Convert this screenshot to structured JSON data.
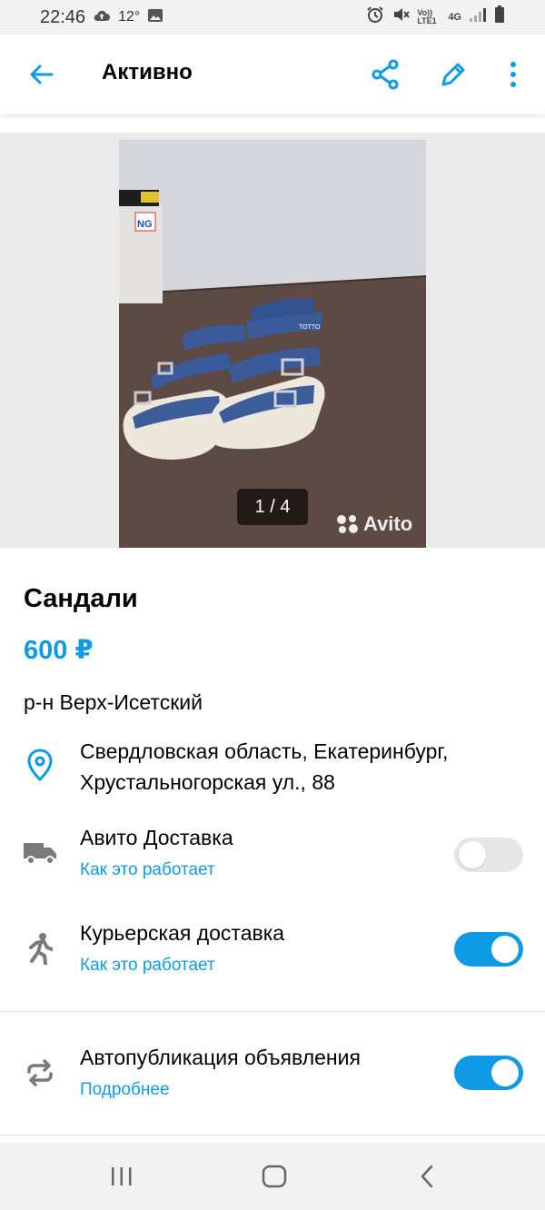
{
  "status_bar": {
    "time": "22:46",
    "temperature": "12°",
    "icons": [
      "cloud-upload-icon",
      "image-icon",
      "alarm-icon",
      "mute-icon",
      "volte-icon",
      "4g-icon",
      "signal-icon",
      "battery-icon"
    ],
    "network_volte": "Vo)) LTE1",
    "network_type": "4G"
  },
  "app_bar": {
    "title": "Активно",
    "icons": [
      "back-arrow-icon",
      "share-icon",
      "edit-pencil-icon",
      "more-vertical-icon"
    ]
  },
  "gallery": {
    "counter": "1 / 4",
    "watermark": "Avito",
    "shoebox_label": "NG",
    "sandal_brand": "TOTTO"
  },
  "listing": {
    "title": "Сандали",
    "price": "600 ₽",
    "district": "р-н Верх-Исетский",
    "address_line1": "Свердловская область, Екатеринбург,",
    "address_line2": "Хрустальногорская ул., 88"
  },
  "options": {
    "avito_delivery": {
      "label": "Авито Доставка",
      "link": "Как это работает",
      "enabled": false,
      "icon": "truck-icon"
    },
    "courier_delivery": {
      "label": "Курьерская доставка",
      "link": "Как это работает",
      "enabled": true,
      "icon": "running-person-icon"
    },
    "autopublish": {
      "label": "Автопубликация объявления",
      "link": "Подробнее",
      "enabled": true,
      "icon": "repeat-arrows-icon"
    }
  },
  "nav_bar": {
    "icons": [
      "recent-apps-icon",
      "home-icon",
      "back-icon"
    ]
  },
  "colors": {
    "accent": "#0f9ae5",
    "toggle_off": "#e6e6e6",
    "icon_gray": "#7a7a7a",
    "status_bar_bg": "#f2f2f2"
  }
}
